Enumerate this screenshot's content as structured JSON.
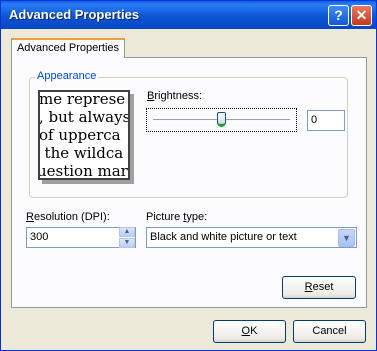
{
  "window": {
    "title": "Advanced Properties",
    "help_glyph": "?",
    "close_glyph": "✕"
  },
  "tab": {
    "label": "Advanced Properties"
  },
  "appearance": {
    "legend": "Appearance",
    "preview_lines": [
      "me represe",
      ", but always",
      " of upperca",
      ", the wildca",
      "uestion mar"
    ]
  },
  "brightness": {
    "label_prefix": "",
    "label_access": "B",
    "label_rest": "rightness:",
    "value": "0",
    "level": 0.5
  },
  "resolution": {
    "label_access": "R",
    "label_rest": "esolution (DPI):",
    "value": "300"
  },
  "picture_type": {
    "label_prefix": "Picture ",
    "label_access": "t",
    "label_rest": "ype:",
    "selected": "Black and white picture or text"
  },
  "buttons": {
    "reset_access": "R",
    "reset_rest": "eset",
    "ok_access": "O",
    "ok_rest": "K",
    "cancel": "Cancel"
  },
  "colors": {
    "titlebar": "#0a56d6",
    "legend": "#0046d5",
    "tab_highlight": "#e8a33b"
  }
}
